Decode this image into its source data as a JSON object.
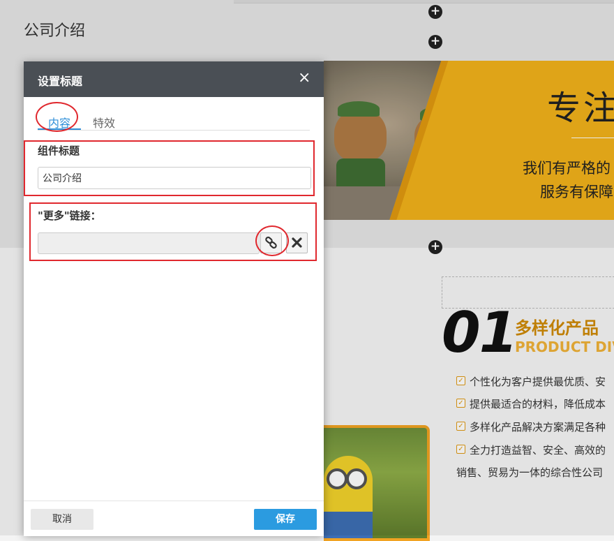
{
  "background": {
    "section_title": "公司介绍",
    "banner_heading": "专注",
    "banner_line1": "我们有严格的",
    "banner_line2": "服务有保障",
    "big_number": "01",
    "product_cn": "多样化产品",
    "product_en": "PRODUCT DIV",
    "features": [
      "个性化为客户提供最优质、安",
      "提供最适合的材料，降低成本",
      "多样化产品解决方案满足各种",
      "全力打造益智、安全、高效的"
    ],
    "last_line": "销售、贸易为一体的综合性公司"
  },
  "dialog": {
    "title": "设置标题",
    "close_glyph": "×",
    "tabs": [
      {
        "label": "内容",
        "active": true
      },
      {
        "label": "特效",
        "active": false
      }
    ],
    "component_title_label": "组件标题",
    "component_title_value": "公司介绍",
    "more_link_label": "\"更多\"链接：",
    "more_link_value": "",
    "cancel_label": "取消",
    "save_label": "保存"
  },
  "icons": {
    "add": "plus-circle-icon",
    "link": "chain-link-icon",
    "clear": "x-mark-icon",
    "check": "checkbox-checked-icon"
  },
  "colors": {
    "accent_blue": "#2f8fd8",
    "save_blue": "#2b9be0",
    "header_dark": "#4a4f55",
    "annotation_red": "#e0282e",
    "brand_orange": "#d08a06",
    "banner_yellow": "#f2b21b"
  }
}
